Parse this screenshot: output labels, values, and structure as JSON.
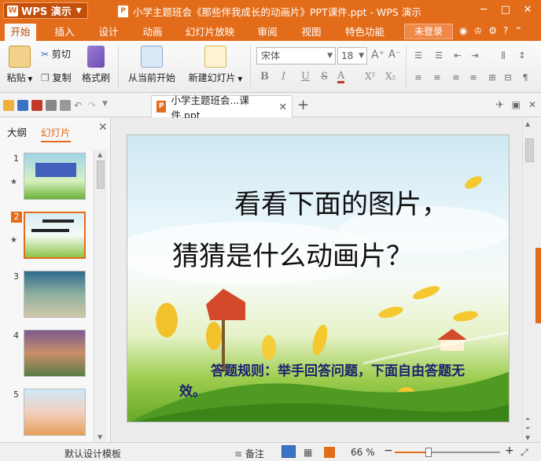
{
  "app": {
    "name": "WPS 演示",
    "window_title": "小学主题班会《那些伴我成长的动画片》PPT课件.ppt - WPS 演示"
  },
  "menu": {
    "tabs": [
      "开始",
      "插入",
      "设计",
      "动画",
      "幻灯片放映",
      "审阅",
      "视图",
      "特色功能"
    ],
    "active_tab": "开始",
    "login": "未登录"
  },
  "ribbon": {
    "paste": "粘贴",
    "cut": "剪切",
    "copy": "复制",
    "format_painter": "格式刷",
    "from_current": "从当前开始",
    "new_slide": "新建幻灯片",
    "font_name": "宋体",
    "font_size": "18"
  },
  "doc_tab": {
    "label": "小学主题班会...课件.ppt"
  },
  "left_panel": {
    "tabs": [
      "大纲",
      "幻灯片"
    ],
    "active_tab": "幻灯片",
    "slides": [
      {
        "num": "1"
      },
      {
        "num": "2"
      },
      {
        "num": "3"
      },
      {
        "num": "4"
      },
      {
        "num": "5"
      }
    ],
    "selected_slide": 2
  },
  "slide": {
    "line1": "看看下面的图片，",
    "line2": "猜猜是什么动画片？",
    "rule": "答题规则：举手回答问题，下面自由答题无效。"
  },
  "status": {
    "template": "默认设计模板",
    "notes": "备注",
    "zoom": "66 %",
    "zoom_fraction": 0.32
  },
  "colors": {
    "accent": "#e36c1a",
    "rule_text": "#1a1f6e"
  }
}
